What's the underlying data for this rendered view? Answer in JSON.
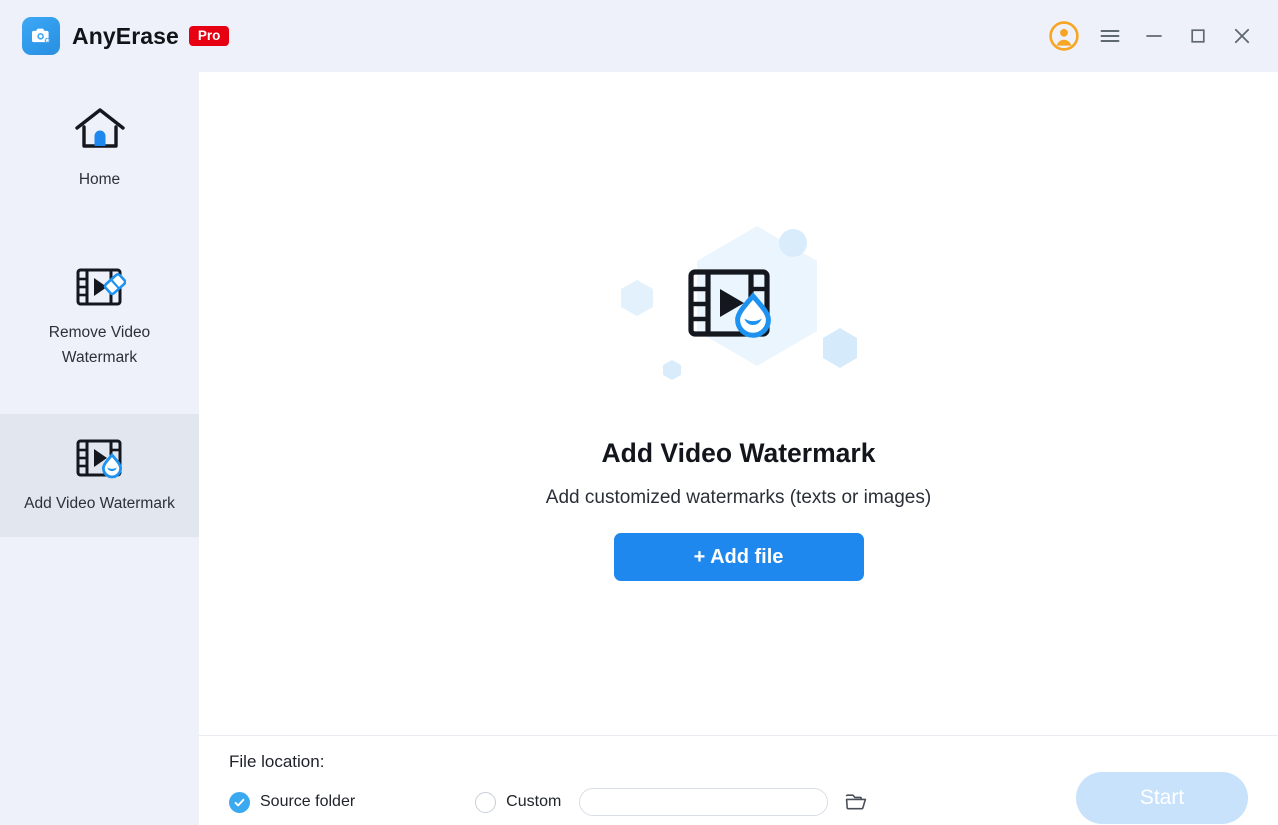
{
  "window": {
    "app_name": "AnyErase",
    "badge": "Pro",
    "logo_icon": "camera-magic-icon",
    "controls": [
      {
        "name": "account-avatar",
        "icon": "user-avatar-icon",
        "label": ""
      },
      {
        "name": "menu",
        "icon": "hamburger-menu-icon",
        "label": ""
      },
      {
        "name": "minimize",
        "icon": "minimize-icon",
        "label": ""
      },
      {
        "name": "maximize",
        "icon": "maximize-icon",
        "label": ""
      },
      {
        "name": "close",
        "icon": "close-icon",
        "label": ""
      }
    ]
  },
  "sidebar": {
    "items": [
      {
        "id": "home",
        "label": "Home",
        "icon": "home-icon",
        "active": false
      },
      {
        "id": "remove-video-watermark",
        "label": "Remove Video Watermark",
        "icon": "film-eraser-icon",
        "active": false
      },
      {
        "id": "add-video-watermark",
        "label": "Add Video Watermark",
        "icon": "film-droplet-icon",
        "active": true
      }
    ]
  },
  "main": {
    "hero_icon": "film-droplet-icon",
    "title": "Add Video Watermark",
    "subtitle": "Add customized watermarks (texts or images)",
    "add_file_label": "+ Add file"
  },
  "footer": {
    "file_location_label": "File location:",
    "options": [
      {
        "id": "source-folder",
        "label": "Source folder",
        "selected": true
      },
      {
        "id": "custom",
        "label": "Custom",
        "selected": false
      }
    ],
    "custom_path_value": "",
    "custom_path_placeholder": "",
    "browse_icon": "folder-open-icon",
    "start_label": "Start",
    "start_enabled": false
  },
  "colors": {
    "accent_blue": "#1e88ef",
    "logo_blue": "#3fa9f5",
    "badge_red": "#e60012",
    "avatar_orange": "#f6a623",
    "sidebar_bg": "#eef1f9",
    "sidebar_active_bg": "#e2e6ef",
    "start_disabled_bg": "#c8e2fb",
    "hex_light": "#e8f4fd",
    "hex_mid": "#d8ecfb"
  }
}
